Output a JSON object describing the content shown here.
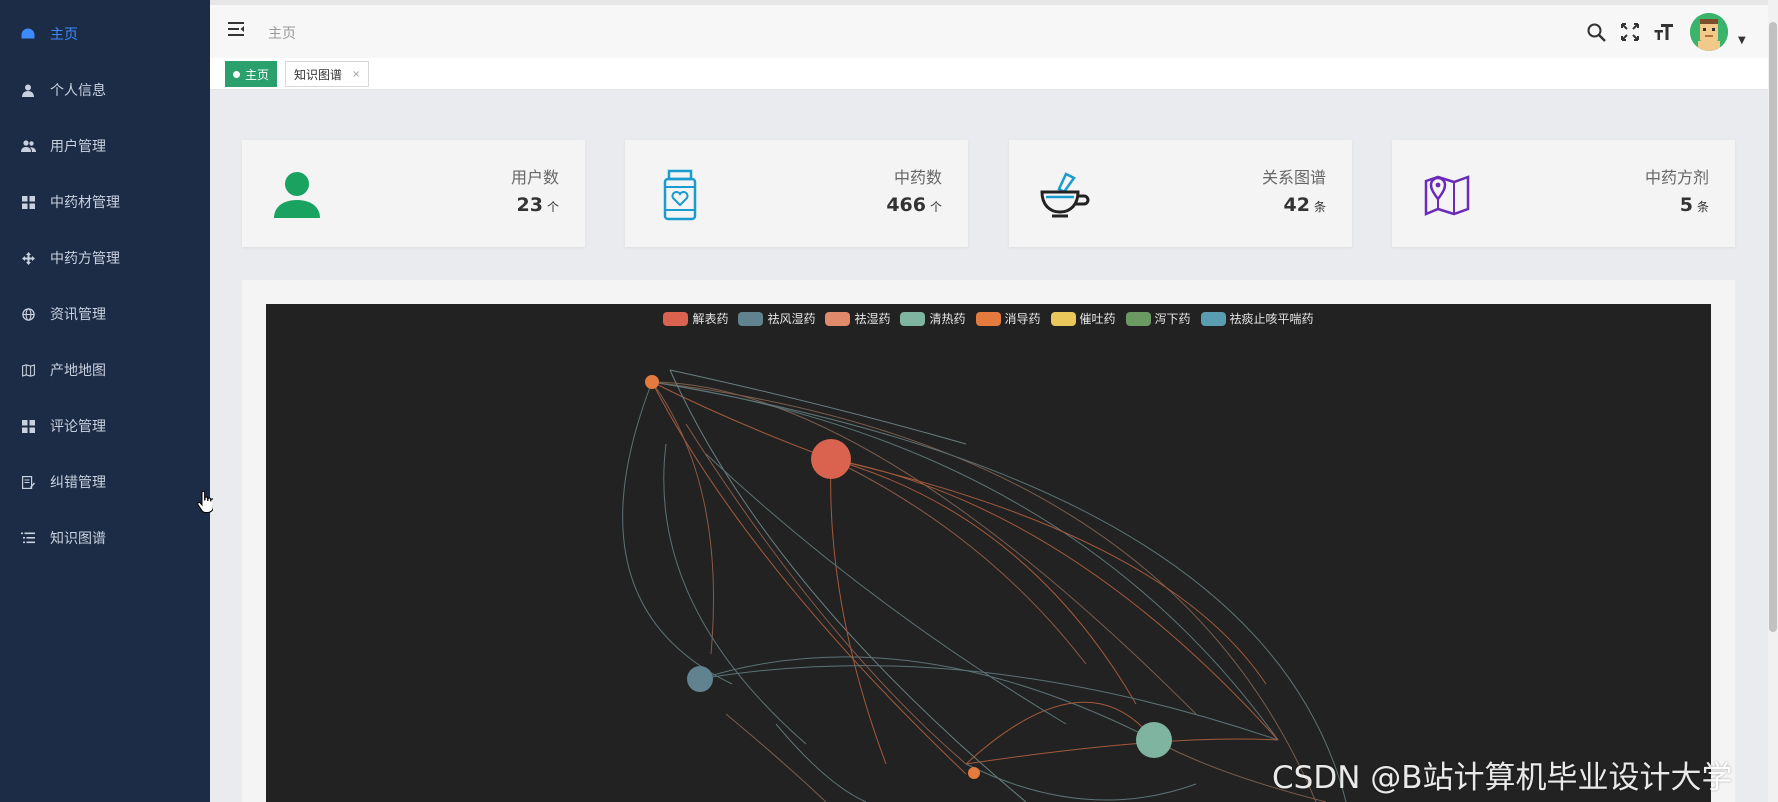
{
  "sidebar": {
    "items": [
      {
        "label": "主页",
        "icon": "dashboard-icon"
      },
      {
        "label": "个人信息",
        "icon": "user-icon"
      },
      {
        "label": "用户管理",
        "icon": "users-icon"
      },
      {
        "label": "中药材管理",
        "icon": "grid-icon"
      },
      {
        "label": "中药方管理",
        "icon": "move-icon"
      },
      {
        "label": "资讯管理",
        "icon": "globe-icon"
      },
      {
        "label": "产地地图",
        "icon": "map-icon"
      },
      {
        "label": "评论管理",
        "icon": "grid-icon"
      },
      {
        "label": "纠错管理",
        "icon": "edit-doc-icon"
      },
      {
        "label": "知识图谱",
        "icon": "list-icon"
      }
    ],
    "active_index": 0
  },
  "header": {
    "breadcrumb": "主页",
    "tools": [
      "search-icon",
      "fullscreen-icon",
      "font-size-icon"
    ]
  },
  "tabs": [
    {
      "label": "主页",
      "active": true
    },
    {
      "label": "知识图谱",
      "close": "×"
    }
  ],
  "cards": [
    {
      "label": "用户数",
      "value": "23",
      "unit": "个",
      "icon": "person-icon",
      "color": "#1aa260"
    },
    {
      "label": "中药数",
      "value": "466",
      "unit": "个",
      "icon": "medicine-bottle-icon",
      "color": "#1a9bd0"
    },
    {
      "label": "关系图谱",
      "value": "42",
      "unit": "条",
      "icon": "mortar-pestle-icon",
      "color": "#222222"
    },
    {
      "label": "中药方剂",
      "value": "5",
      "unit": "条",
      "icon": "map-pin-icon",
      "color": "#6b2bb8"
    }
  ],
  "graph": {
    "background": "#222222",
    "legend": [
      {
        "name": "解表药",
        "color": "#d9634f"
      },
      {
        "name": "祛风湿药",
        "color": "#61828f"
      },
      {
        "name": "祛湿药",
        "color": "#e08a6b"
      },
      {
        "name": "清热药",
        "color": "#7fb4a0"
      },
      {
        "name": "消导药",
        "color": "#e57a3f"
      },
      {
        "name": "催吐药",
        "color": "#e9c75a"
      },
      {
        "name": "泻下药",
        "color": "#6a9a62"
      },
      {
        "name": "祛痰止咳平喘药",
        "color": "#5a9db0"
      }
    ]
  },
  "watermark": "CSDN @B站计算机毕业设计大学"
}
